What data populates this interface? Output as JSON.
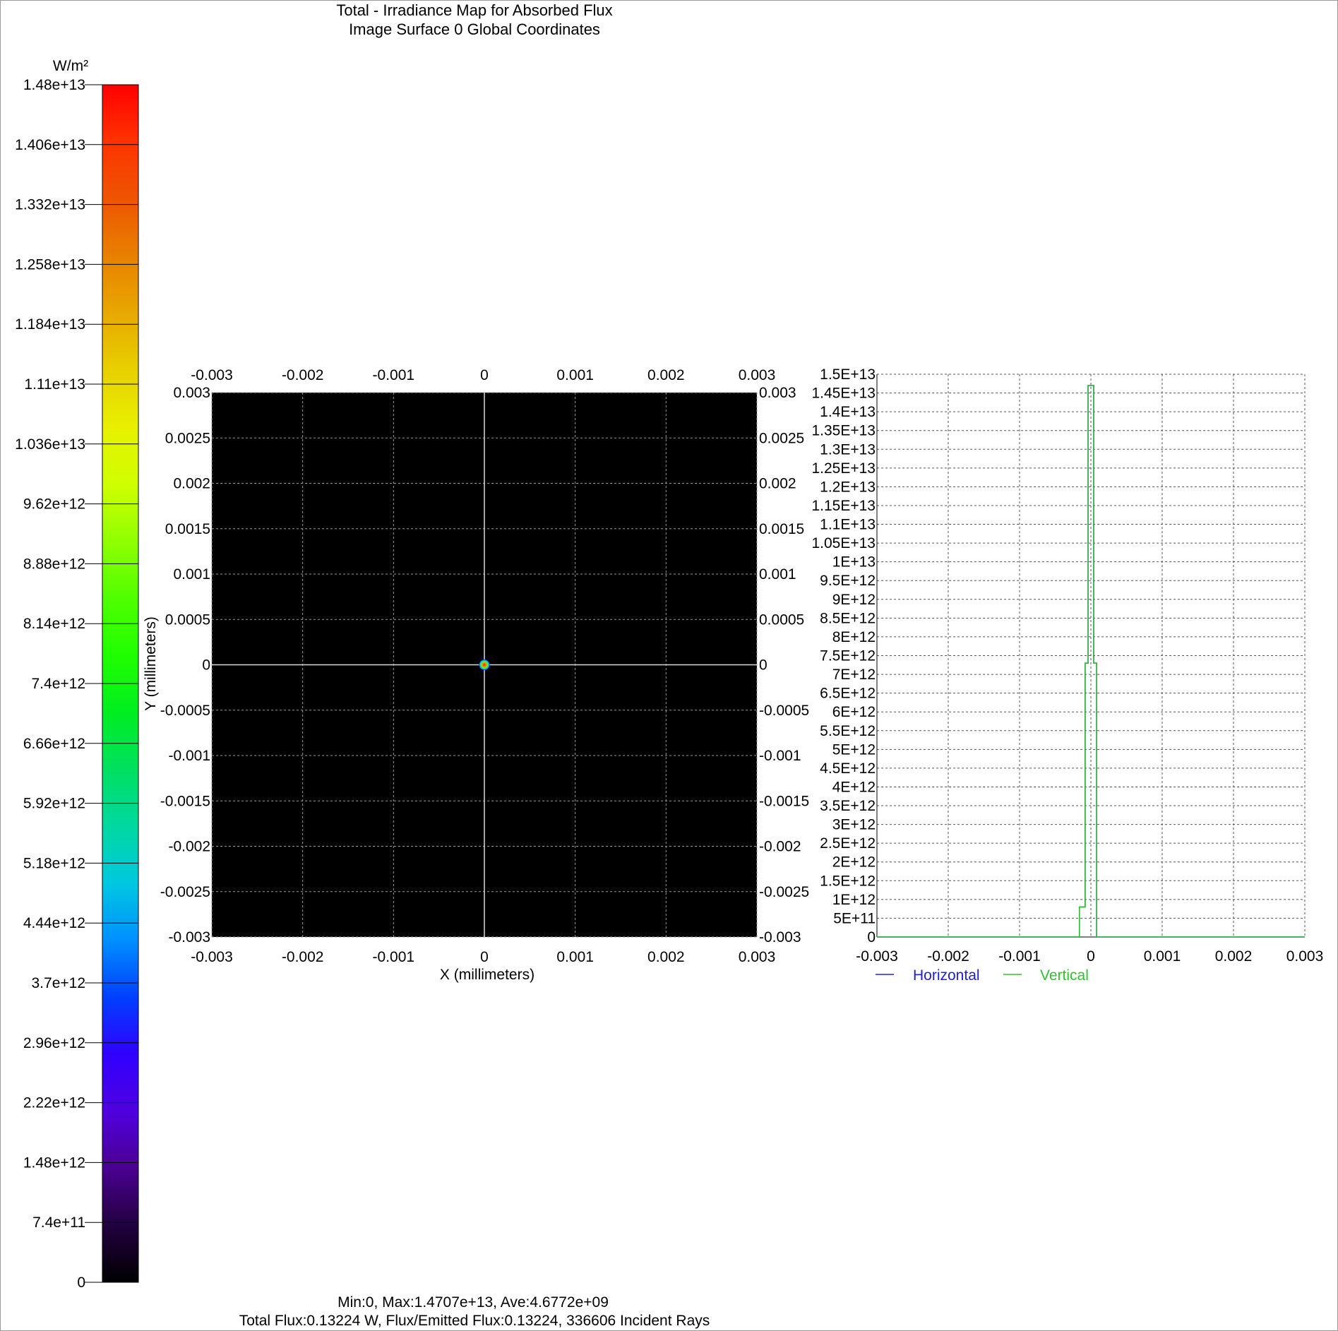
{
  "title": {
    "line1": "Total - Irradiance Map for Absorbed Flux",
    "line2": "Image Surface 0    Global Coordinates"
  },
  "footer": {
    "line1": "Min:0, Max:1.4707e+13, Ave:4.6772e+09",
    "line2": "Total Flux:0.13224 W, Flux/Emitted Flux:0.13224, 336606 Incident Rays"
  },
  "colors": {
    "map_background": "#000000",
    "grid": "#9a9a9a",
    "horizontal": "#2020d0",
    "vertical": "#30c030"
  },
  "chart_data": [
    {
      "type": "colorbar",
      "unit": "W/m²",
      "range": [
        0,
        14800000000000.0
      ],
      "ticks": [
        "1.48e+13",
        "1.406e+13",
        "1.332e+13",
        "1.258e+13",
        "1.184e+13",
        "1.11e+13",
        "1.036e+13",
        "9.62e+12",
        "8.88e+12",
        "8.14e+12",
        "7.4e+12",
        "6.66e+12",
        "5.92e+12",
        "5.18e+12",
        "4.44e+12",
        "3.7e+12",
        "2.96e+12",
        "2.22e+12",
        "1.48e+12",
        "7.4e+11",
        "0"
      ],
      "colormap": [
        "#ff0000",
        "#ff3300",
        "#ee5500",
        "#e88000",
        "#e8a800",
        "#e8d000",
        "#e8f000",
        "#d0ff00",
        "#90ff00",
        "#50ff00",
        "#20ff00",
        "#00ee20",
        "#00e060",
        "#00d8a0",
        "#00c8e0",
        "#0090ff",
        "#0040ff",
        "#3000ff",
        "#5000e0",
        "#4a0090",
        "#220040",
        "#000000"
      ]
    },
    {
      "type": "heatmap",
      "xlabel": "X (millimeters)",
      "ylabel": "Y (millimeters)",
      "xlim": [
        -0.003,
        0.003
      ],
      "ylim": [
        -0.003,
        0.003
      ],
      "x_ticks": [
        "-0.003",
        "-0.002",
        "-0.001",
        "0",
        "0.001",
        "0.002",
        "0.003"
      ],
      "y_ticks": [
        "0.003",
        "0.0025",
        "0.002",
        "0.0015",
        "0.001",
        "0.0005",
        "0",
        "-0.0005",
        "-0.001",
        "-0.0015",
        "-0.002",
        "-0.0025",
        "-0.003"
      ],
      "grid": true,
      "spot": {
        "x": 0,
        "y": 0,
        "peak": 14707000000000.0
      }
    },
    {
      "type": "line",
      "xlim": [
        -0.003,
        0.003
      ],
      "ylim": [
        0,
        15000000000000.0
      ],
      "x_ticks": [
        "-0.003",
        "-0.002",
        "-0.001",
        "0",
        "0.001",
        "0.002",
        "0.003"
      ],
      "y_ticks": [
        "1.5E+13",
        "1.45E+13",
        "1.4E+13",
        "1.35E+13",
        "1.3E+13",
        "1.25E+13",
        "1.2E+13",
        "1.15E+13",
        "1.1E+13",
        "1.05E+13",
        "1E+13",
        "9.5E+12",
        "9E+12",
        "8.5E+12",
        "8E+12",
        "7.5E+12",
        "7E+12",
        "6.5E+12",
        "6E+12",
        "5.5E+12",
        "5E+12",
        "4.5E+12",
        "4E+12",
        "3.5E+12",
        "3E+12",
        "2.5E+12",
        "2E+12",
        "1.5E+12",
        "1E+12",
        "5E+11",
        "0"
      ],
      "grid": true,
      "legend_position": "bottom",
      "series": [
        {
          "name": "Horizontal",
          "x": [
            -0.003,
            -0.00016,
            -0.00016,
            -8e-05,
            -8e-05,
            -4e-05,
            -4e-05,
            4e-05,
            4e-05,
            8e-05,
            8e-05,
            0.003
          ],
          "y": [
            0,
            0,
            800000000000.0,
            800000000000.0,
            7300000000000.0,
            7300000000000.0,
            14700000000000.0,
            14700000000000.0,
            7300000000000.0,
            7300000000000.0,
            0,
            0
          ]
        },
        {
          "name": "Vertical",
          "x": [
            -0.003,
            -0.00016,
            -0.00016,
            -8e-05,
            -8e-05,
            -4e-05,
            -4e-05,
            4e-05,
            4e-05,
            8e-05,
            8e-05,
            0.003
          ],
          "y": [
            0,
            0,
            800000000000.0,
            800000000000.0,
            7300000000000.0,
            7300000000000.0,
            14700000000000.0,
            14700000000000.0,
            7300000000000.0,
            7300000000000.0,
            0,
            0
          ]
        }
      ]
    }
  ]
}
